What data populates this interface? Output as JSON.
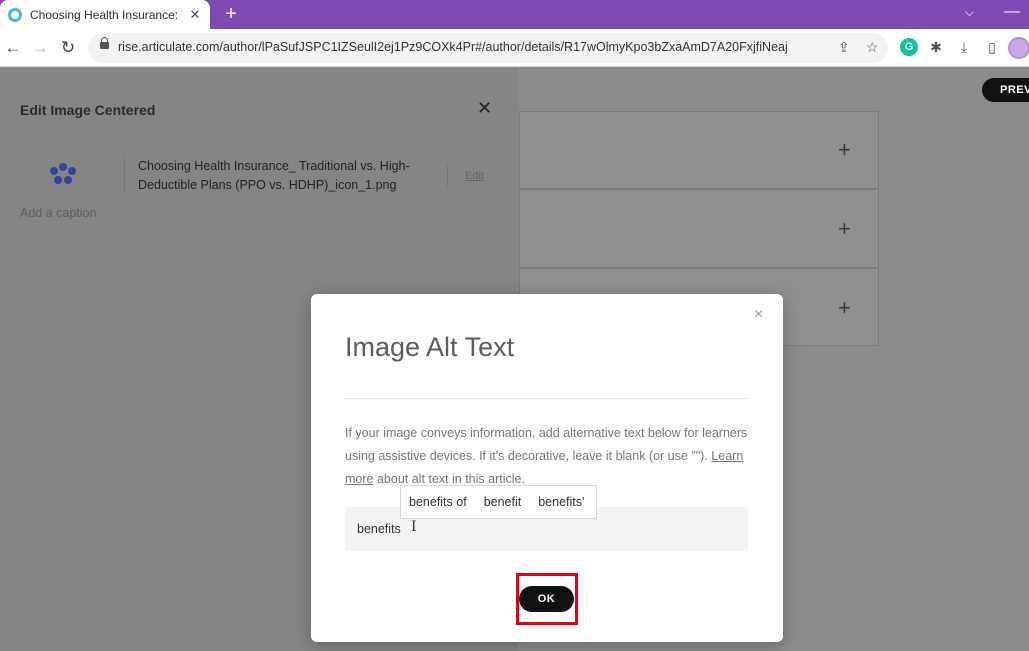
{
  "browser": {
    "tab_title": "Choosing Health Insurance: Trad",
    "tab_close": "✕",
    "new_tab": "+",
    "tabbar_chevron": "⌵",
    "window_minimize": "—",
    "url": "rise.articulate.com/author/lPaSufJSPC1IZSeulI2ej1Pz9COXk4Pr#/author/details/R17wOlmyKpo3bZxaAmD7A20FxjfiNeaj",
    "nav": {
      "back": "←",
      "forward": "→",
      "reload": "↻"
    },
    "icons": {
      "share": "⇪",
      "star": "☆",
      "grammarly": "G",
      "extensions": "✱",
      "download": "⤓",
      "sidebar": "▯"
    }
  },
  "editor": {
    "preview_label": "PREV",
    "plus_symbol": "+"
  },
  "panel": {
    "title": "Edit Image Centered",
    "close": "✕",
    "file_name": "Choosing Health Insurance_ Traditional vs. High-Deductible Plans (PPO vs. HDHP)_icon_1.png",
    "edit_label": "Edit",
    "caption_placeholder": "Add a caption"
  },
  "modal": {
    "close": "×",
    "title": "Image Alt Text",
    "description": "If your image conveys information, add alternative text below for learners using assistive devices. If it's decorative, leave it blank (or use \"\").",
    "learn_more_link": "Learn more",
    "learn_more_rest": " about alt text in this article.",
    "alt_text_value": "benefits",
    "cursor_glyph": "I",
    "suggestions": [
      "benefits of",
      "benefit",
      "benefits'"
    ],
    "ok_label": "OK"
  },
  "colors": {
    "tab_strip": "#7d4bb3",
    "highlight": "#e2001a",
    "icon_blue": "#33439a"
  }
}
